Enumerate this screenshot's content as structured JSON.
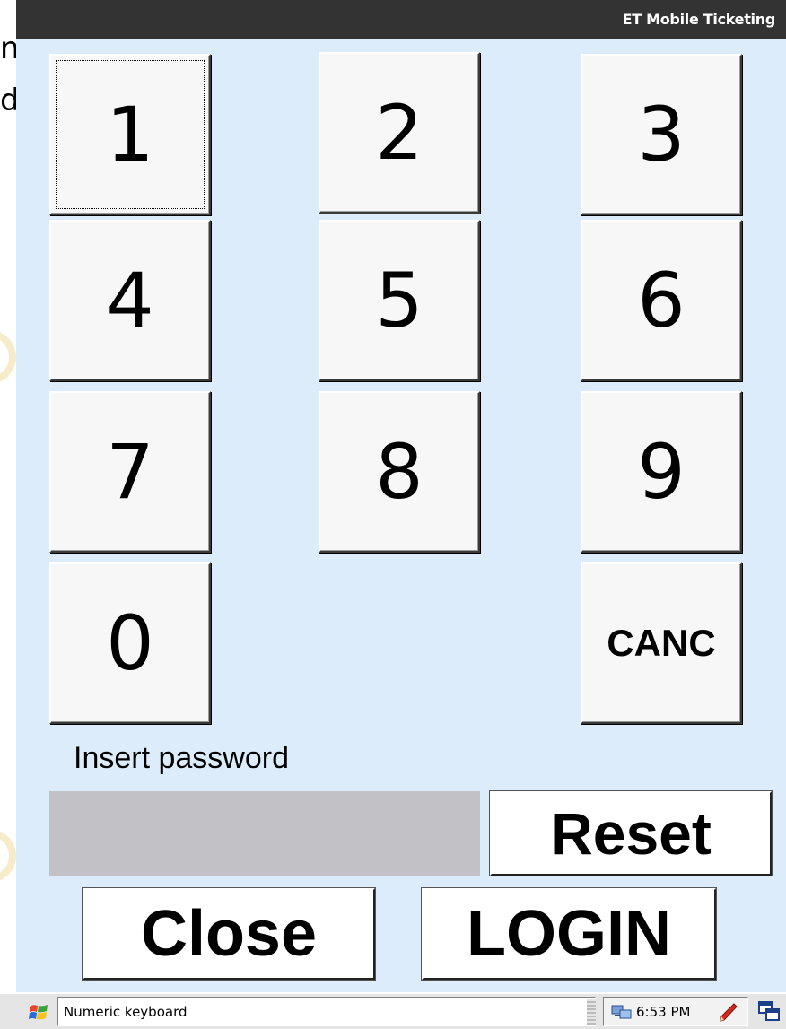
{
  "background": {
    "fragment_line1": "n",
    "fragment_line2": "d,"
  },
  "window": {
    "title": "ET Mobile Ticketing"
  },
  "keypad": {
    "keys": [
      "1",
      "2",
      "3",
      "4",
      "5",
      "6",
      "7",
      "8",
      "9",
      "0",
      "CANC"
    ]
  },
  "login": {
    "prompt": "Insert password",
    "password_value": "",
    "reset_label": "Reset",
    "close_label": "Close",
    "login_label": "LOGIN"
  },
  "taskbar": {
    "status_text": "Numeric keyboard",
    "clock": "6:53 PM",
    "start_icon": "windows-start-icon",
    "network_icon": "network-icon",
    "input_icon": "pen-icon",
    "switch_icon": "window-switch-icon"
  },
  "colors": {
    "window_bg": "#dcecfb",
    "titlebar_bg": "#333333",
    "password_field_bg": "#c2c2c6"
  }
}
